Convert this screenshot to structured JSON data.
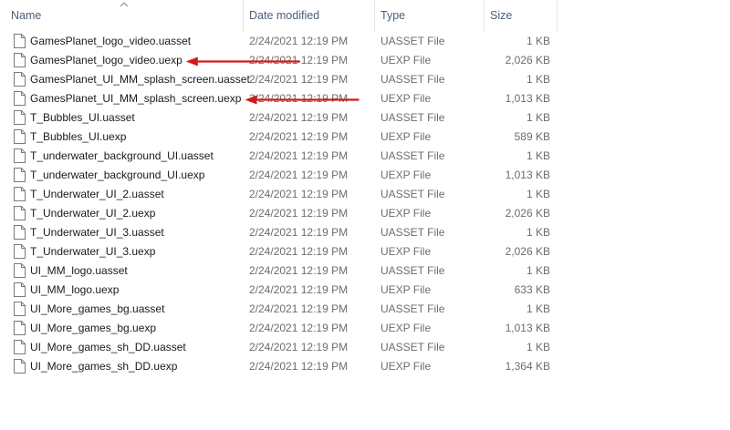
{
  "columns": {
    "name": "Name",
    "date_modified": "Date modified",
    "type": "Type",
    "size": "Size"
  },
  "sort": {
    "column": "name",
    "direction": "ascending"
  },
  "files": [
    {
      "name": "GamesPlanet_logo_video.uasset",
      "date": "2/24/2021 12:19 PM",
      "type": "UASSET File",
      "size": "1 KB"
    },
    {
      "name": "GamesPlanet_logo_video.uexp",
      "date": "2/24/2021 12:19 PM",
      "type": "UEXP File",
      "size": "2,026 KB"
    },
    {
      "name": "GamesPlanet_UI_MM_splash_screen.uasset",
      "date": "2/24/2021 12:19 PM",
      "type": "UASSET File",
      "size": "1 KB"
    },
    {
      "name": "GamesPlanet_UI_MM_splash_screen.uexp",
      "date": "2/24/2021 12:19 PM",
      "type": "UEXP File",
      "size": "1,013 KB"
    },
    {
      "name": "T_Bubbles_UI.uasset",
      "date": "2/24/2021 12:19 PM",
      "type": "UASSET File",
      "size": "1 KB"
    },
    {
      "name": "T_Bubbles_UI.uexp",
      "date": "2/24/2021 12:19 PM",
      "type": "UEXP File",
      "size": "589 KB"
    },
    {
      "name": "T_underwater_background_UI.uasset",
      "date": "2/24/2021 12:19 PM",
      "type": "UASSET File",
      "size": "1 KB"
    },
    {
      "name": "T_underwater_background_UI.uexp",
      "date": "2/24/2021 12:19 PM",
      "type": "UEXP File",
      "size": "1,013 KB"
    },
    {
      "name": "T_Underwater_UI_2.uasset",
      "date": "2/24/2021 12:19 PM",
      "type": "UASSET File",
      "size": "1 KB"
    },
    {
      "name": "T_Underwater_UI_2.uexp",
      "date": "2/24/2021 12:19 PM",
      "type": "UEXP File",
      "size": "2,026 KB"
    },
    {
      "name": "T_Underwater_UI_3.uasset",
      "date": "2/24/2021 12:19 PM",
      "type": "UASSET File",
      "size": "1 KB"
    },
    {
      "name": "T_Underwater_UI_3.uexp",
      "date": "2/24/2021 12:19 PM",
      "type": "UEXP File",
      "size": "2,026 KB"
    },
    {
      "name": "UI_MM_logo.uasset",
      "date": "2/24/2021 12:19 PM",
      "type": "UASSET File",
      "size": "1 KB"
    },
    {
      "name": "UI_MM_logo.uexp",
      "date": "2/24/2021 12:19 PM",
      "type": "UEXP File",
      "size": "633 KB"
    },
    {
      "name": "UI_More_games_bg.uasset",
      "date": "2/24/2021 12:19 PM",
      "type": "UASSET File",
      "size": "1 KB"
    },
    {
      "name": "UI_More_games_bg.uexp",
      "date": "2/24/2021 12:19 PM",
      "type": "UEXP File",
      "size": "1,013 KB"
    },
    {
      "name": "UI_More_games_sh_DD.uasset",
      "date": "2/24/2021 12:19 PM",
      "type": "UASSET File",
      "size": "1 KB"
    },
    {
      "name": "UI_More_games_sh_DD.uexp",
      "date": "2/24/2021 12:19 PM",
      "type": "UEXP File",
      "size": "1,364 KB"
    }
  ],
  "annotations": {
    "arrow_color": "#d11a1a",
    "arrows": [
      {
        "points_to": "GamesPlanet_logo_video.uexp"
      },
      {
        "points_to": "GamesPlanet_UI_MM_splash_screen.uexp"
      }
    ]
  },
  "icons": {
    "file": "generic-file-icon",
    "sort": "sort-ascending-icon"
  },
  "colors": {
    "header_text": "#4c607a",
    "name_text": "#1a1a1a",
    "meta_text": "#6d6d6d",
    "separator": "#e5e5e5"
  }
}
